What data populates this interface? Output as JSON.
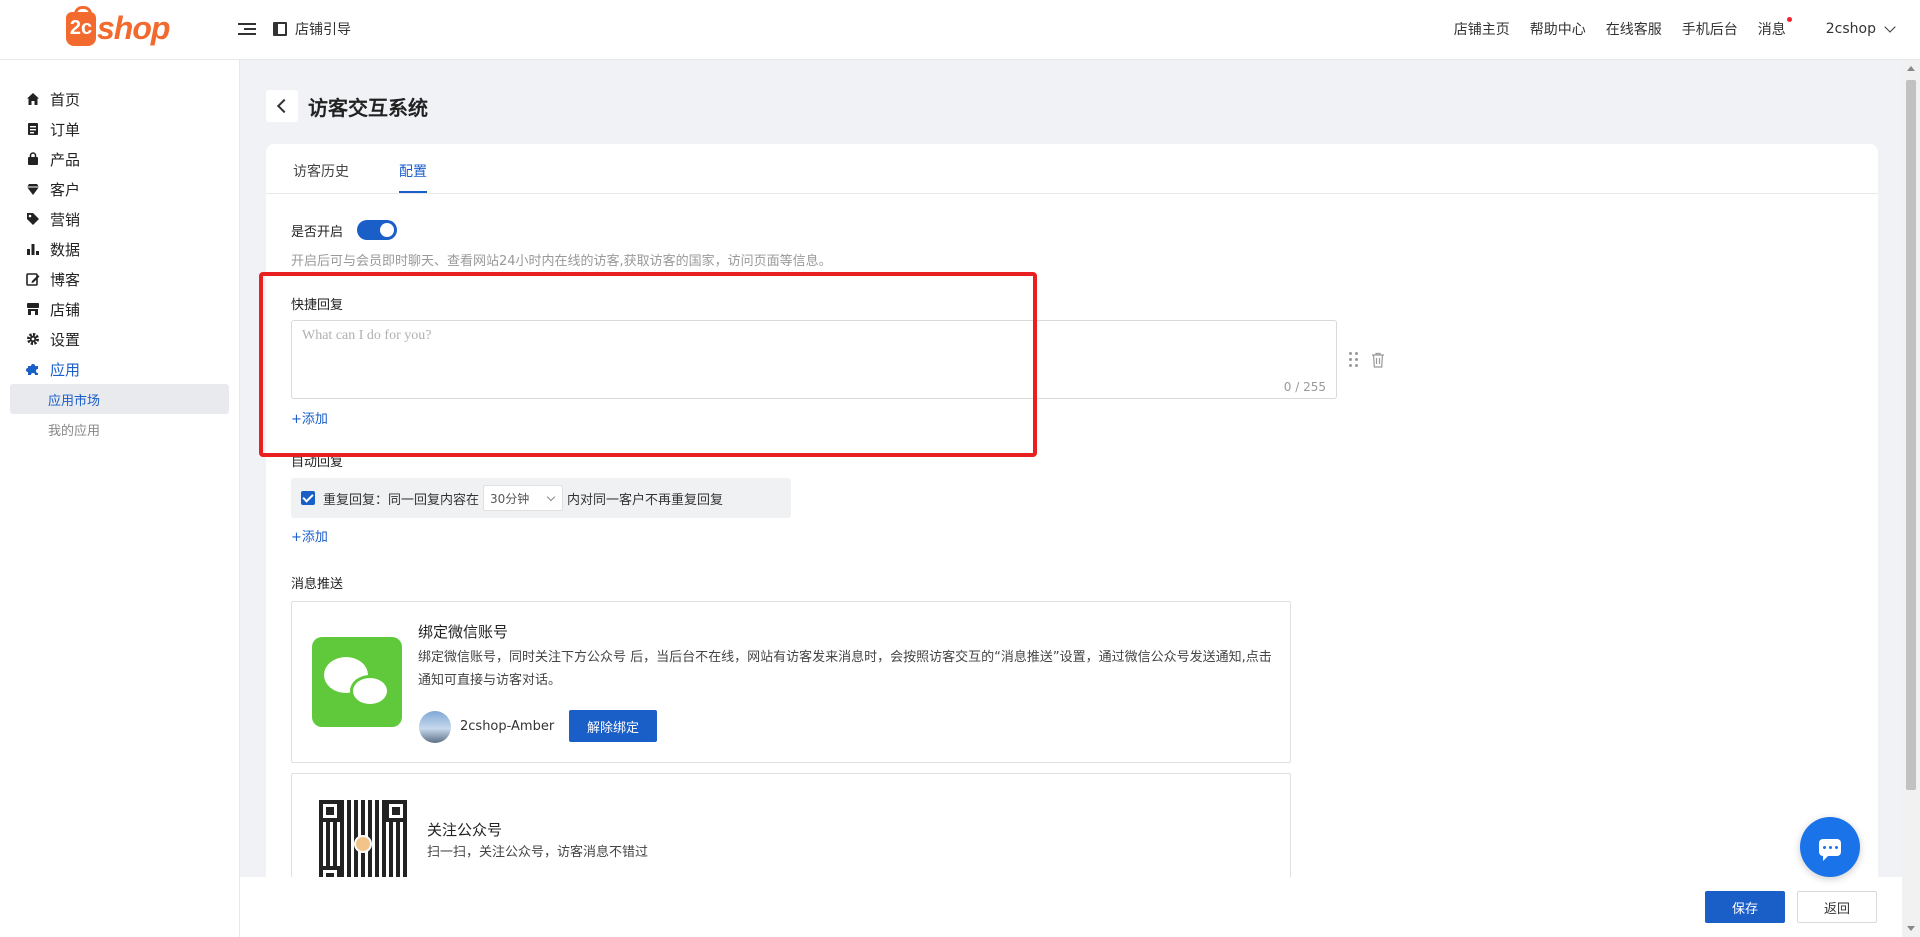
{
  "header": {
    "logo_prefix": "2c",
    "logo_word": "shop",
    "guide_label": "店铺引导",
    "nav": [
      "店铺主页",
      "帮助中心",
      "在线客服",
      "手机后台",
      "消息"
    ],
    "user": "2cshop"
  },
  "sidebar": {
    "items": [
      {
        "label": "首页",
        "icon": "home-icon"
      },
      {
        "label": "订单",
        "icon": "order-icon"
      },
      {
        "label": "产品",
        "icon": "bag-icon"
      },
      {
        "label": "客户",
        "icon": "diamond-icon"
      },
      {
        "label": "营销",
        "icon": "tag-icon"
      },
      {
        "label": "数据",
        "icon": "bar-chart-icon"
      },
      {
        "label": "博客",
        "icon": "edit-icon"
      },
      {
        "label": "店铺",
        "icon": "store-icon"
      },
      {
        "label": "设置",
        "icon": "gear-icon"
      },
      {
        "label": "应用",
        "icon": "puzzle-icon"
      }
    ],
    "sub_items": [
      "应用市场",
      "我的应用"
    ]
  },
  "page": {
    "title": "访客交互系统",
    "tabs": [
      "访客历史",
      "配置"
    ],
    "enable_label": "是否开启",
    "enable_hint": "开启后可与会员即时聊天、查看网站24小时内在线的访客,获取访客的国家，访问页面等信息。",
    "quick_reply": {
      "label": "快捷回复",
      "placeholder": "What can I do for you?",
      "counter": "0 / 255",
      "add": "+添加"
    },
    "auto_reply": {
      "label": "自动回复",
      "text_before": "重复回复：同一回复内容在",
      "select_value": "30分钟",
      "text_after": "内对同一客户不再重复回复",
      "add": "+添加"
    },
    "push": {
      "label": "消息推送",
      "wechat_title": "绑定微信账号",
      "wechat_desc": "绑定微信账号，同时关注下方公众号 后，当后台不在线，网站有访客发来消息时，会按照访客交互的“消息推送”设置，通过微信公众号发送通知,点击通知可直接与访客对话。",
      "bound_user": "2cshop-Amber",
      "unbind": "解除绑定",
      "follow_title": "关注公众号",
      "follow_desc": "扫一扫，关注公众号，访客消息不错过"
    }
  },
  "footer": {
    "save": "保存",
    "back": "返回"
  },
  "colors": {
    "primary": "#1a5ec8",
    "brand": "#f26a2e",
    "highlight": "#e8201f",
    "wechat": "#5fc93b"
  }
}
